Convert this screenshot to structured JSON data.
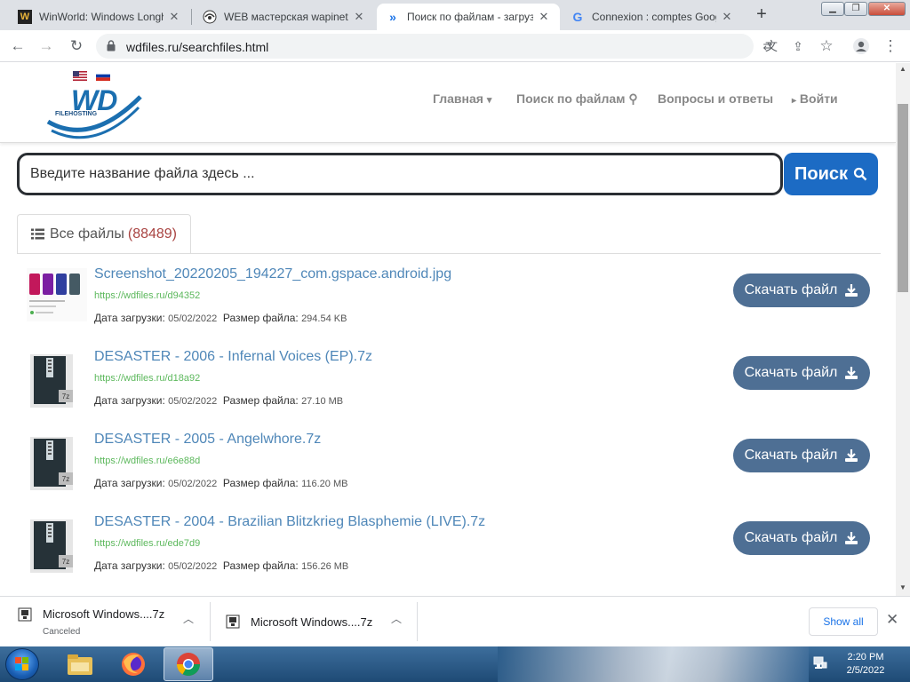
{
  "browser": {
    "tabs": [
      {
        "title": "WinWorld: Windows Longh",
        "favicon": "winworld-icon"
      },
      {
        "title": "WEB мастерская wapinet.r",
        "favicon": "wapinet-icon"
      },
      {
        "title": "Поиск по файлам - загруз",
        "favicon": "wdfiles-icon",
        "active": true
      },
      {
        "title": "Connexion : comptes Goog",
        "favicon": "google-icon"
      }
    ],
    "new_tab_label": "+",
    "url": "wdfiles.ru/searchfiles.html"
  },
  "site": {
    "logo_text": "WD",
    "logo_subtext": "FILEHOSTING",
    "nav": [
      {
        "label": "Главная",
        "suffix": "▾"
      },
      {
        "label": "Поиск по файлам",
        "suffix": "⚲"
      },
      {
        "label": "Вопросы и ответы",
        "suffix": ""
      },
      {
        "label": "Войти",
        "prefix": "▸"
      }
    ],
    "search": {
      "placeholder": "Введите название файла здесь ...",
      "button_label": "Поиск"
    },
    "files_tab": {
      "label": "Все файлы",
      "count": "(88489)"
    },
    "meta_labels": {
      "date": "Дата загрузки:",
      "size": "Размер файла:"
    },
    "download_label": "Скачать файл",
    "files": [
      {
        "name": "Screenshot_20220205_194227_com.gspace.android.jpg",
        "url": "https://wdfiles.ru/d94352",
        "date": "05/02/2022",
        "size": "294.54 KB",
        "thumb": "image"
      },
      {
        "name": "DESASTER - 2006 - Infernal Voices (EP).7z",
        "url": "https://wdfiles.ru/d18a92",
        "date": "05/02/2022",
        "size": "27.10 MB",
        "thumb": "7z"
      },
      {
        "name": "DESASTER - 2005 - Angelwhore.7z",
        "url": "https://wdfiles.ru/e6e88d",
        "date": "05/02/2022",
        "size": "116.20 MB",
        "thumb": "7z"
      },
      {
        "name": "DESASTER - 2004 - Brazilian Blitzkrieg Blasphemie (LIVE).7z",
        "url": "https://wdfiles.ru/ede7d9",
        "date": "05/02/2022",
        "size": "156.26 MB",
        "thumb": "7z"
      }
    ]
  },
  "downloads": {
    "items": [
      {
        "name": "Microsoft Windows....7z",
        "status": "Canceled"
      },
      {
        "name": "Microsoft Windows....7z",
        "status": ""
      }
    ],
    "show_all_label": "Show all"
  },
  "taskbar": {
    "time": "2:20 PM",
    "date": "2/5/2022"
  },
  "colors": {
    "accent": "#1c6bc4",
    "download_button": "#4e6f94",
    "link": "#4f87b8",
    "url_green": "#5cb85c",
    "count_red": "#a94442"
  }
}
